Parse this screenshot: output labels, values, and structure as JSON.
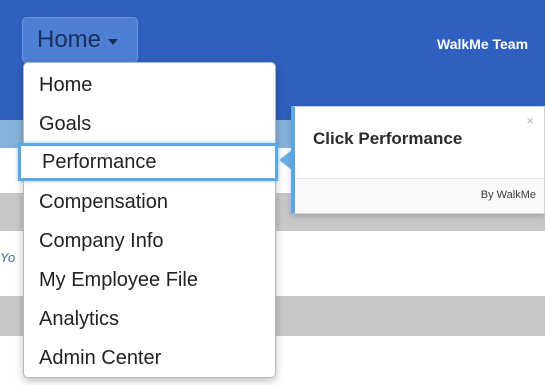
{
  "header": {
    "home_button_label": "Home",
    "team_label": "WalkMe Team"
  },
  "menu": {
    "items": [
      {
        "label": "Home"
      },
      {
        "label": "Goals"
      },
      {
        "label": "Performance",
        "highlighted": true
      },
      {
        "label": "Compensation"
      },
      {
        "label": "Company Info"
      },
      {
        "label": "My Employee File"
      },
      {
        "label": "Analytics"
      },
      {
        "label": "Admin Center"
      }
    ]
  },
  "tooltip": {
    "text": "Click Performance",
    "close_symbol": "×",
    "brand": "By WalkMe"
  },
  "page": {
    "partial_text": "Yo"
  },
  "colors": {
    "header_bg": "#2f5fbf",
    "highlight_border": "#5aa6e6",
    "band_gray": "#c8c8c8"
  }
}
